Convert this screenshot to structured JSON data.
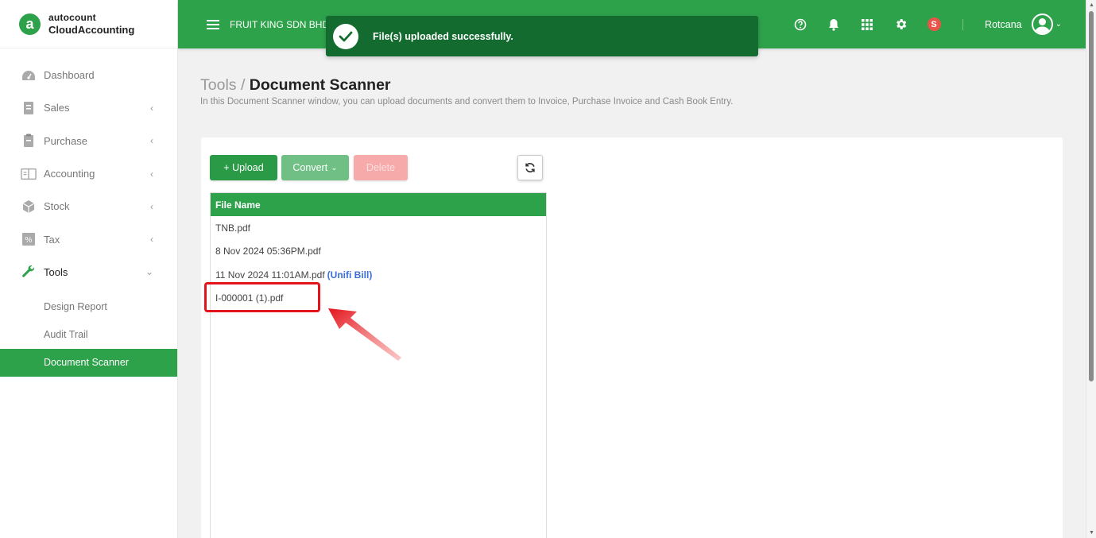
{
  "app": {
    "logo_top": "autocount",
    "logo_bottom": "CloudAccounting",
    "company": "FRUIT KING SDN BHD",
    "user": "Rotcana",
    "notification_badge": "S"
  },
  "sidebar": {
    "items": [
      {
        "label": "Dashboard",
        "icon": "dashboard-icon"
      },
      {
        "label": "Sales",
        "icon": "sales-icon"
      },
      {
        "label": "Purchase",
        "icon": "purchase-icon"
      },
      {
        "label": "Accounting",
        "icon": "accounting-icon"
      },
      {
        "label": "Stock",
        "icon": "stock-icon"
      },
      {
        "label": "Tax",
        "icon": "tax-icon"
      },
      {
        "label": "Tools",
        "icon": "wrench-icon"
      }
    ],
    "tools_sub": [
      "Design Report",
      "Audit Trail",
      "Document Scanner"
    ]
  },
  "toast": {
    "message": "File(s) uploaded successfully."
  },
  "page": {
    "breadcrumb_parent": "Tools",
    "breadcrumb_sep": " / ",
    "title": "Document Scanner",
    "description": "In this Document Scanner window, you can upload documents and convert them to Invoice, Purchase Invoice and Cash Book Entry."
  },
  "toolbar": {
    "upload_label": "+ Upload",
    "convert_label": "Convert",
    "delete_label": "Delete"
  },
  "table": {
    "header": "File Name",
    "rows": [
      {
        "name": "TNB.pdf",
        "tag": ""
      },
      {
        "name": "8 Nov 2024 05:36PM.pdf",
        "tag": ""
      },
      {
        "name": "11 Nov 2024 11:01AM.pdf",
        "tag": "(Unifi Bill)"
      },
      {
        "name": "I-000001 (1).pdf",
        "tag": ""
      }
    ]
  },
  "colors": {
    "brand_green": "#2ea14b",
    "toast_green": "#146b2f",
    "annotation_red": "#e3141b",
    "tag_blue": "#3b6fd6"
  }
}
